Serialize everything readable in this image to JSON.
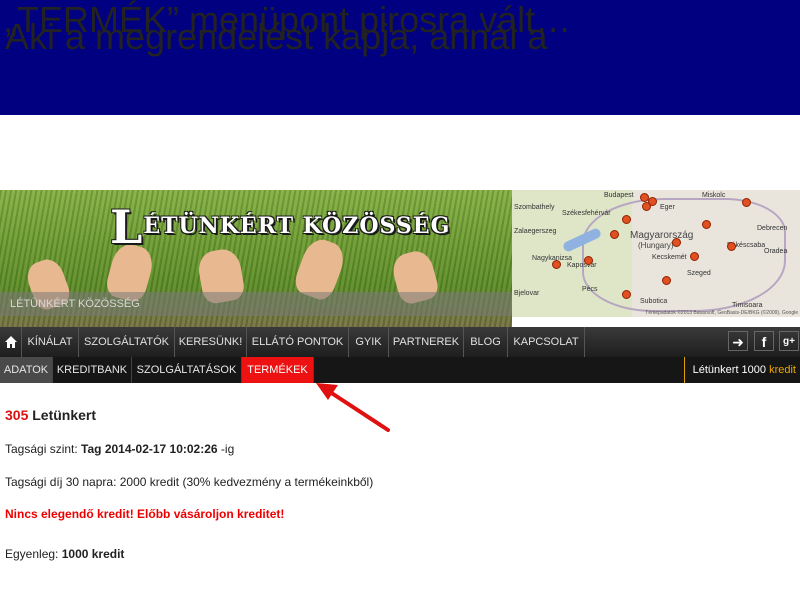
{
  "slide": {
    "title_line1": "Aki a megrendelést kapja, annál a",
    "title_line2": "„TERMÉK” menüpont pirosra vált…"
  },
  "banner": {
    "logo_initial": "L",
    "logo_text": "ÉTÜNKÉRT KÖZÖSSÉG",
    "caption": "LÉTÜNKÉRT KÖZÖSSÉG",
    "map": {
      "country": "Magyarország",
      "country_sub": "(Hungary)",
      "cities": [
        "Budapest",
        "Szombathely",
        "Székesfehérvár",
        "Zalaegerszeg",
        "Kaposvár",
        "Nagykanizsa",
        "Pécs",
        "Szeged",
        "Debrecen",
        "Miskolc",
        "Eger",
        "Kecskemét",
        "Békéscsaba",
        "Oradea",
        "Timisoara",
        "Subotica",
        "Bjelovar"
      ],
      "attribution": "Térképadatok ©2013 Basarsoft, GeoBasis-DE/BKG (©2009), Google"
    }
  },
  "mainnav": {
    "items": [
      "KÍNÁLAT",
      "SZOLGÁLTATÓK",
      "KERESÜNK!",
      "ELLÁTÓ PONTOK",
      "GYIK",
      "PARTNEREK",
      "BLOG",
      "KAPCSOLAT"
    ],
    "icons": [
      "home-icon",
      "logout-icon",
      "facebook-icon",
      "google-plus-icon"
    ]
  },
  "subnav": {
    "items": [
      "ADATOK",
      "KREDITBANK",
      "SZOLGÁLTATÁSOK",
      "TERMÉKEK"
    ],
    "credit_label": "Létünkert 1000",
    "credit_unit": "kredit",
    "active_color": "#ee1111"
  },
  "content": {
    "user_number": "305",
    "user_name": "Letünkert",
    "membership_label": "Tagsági szint:",
    "membership_value": "Tag 2014-02-17 10:02:26",
    "membership_suffix": "-ig",
    "fee_text": "Tagsági díj 30 napra: 2000 kredit (30% kedvezmény a termékeinkből)",
    "warning": "Nincs elegendő kredit! Előbb vásároljon kreditet!",
    "balance_label": "Egyenleg:",
    "balance_value": "1000 kredit"
  },
  "colors": {
    "title_bg": "#000080",
    "highlight_red": "#ee1111",
    "arrow_red": "#e01010"
  }
}
